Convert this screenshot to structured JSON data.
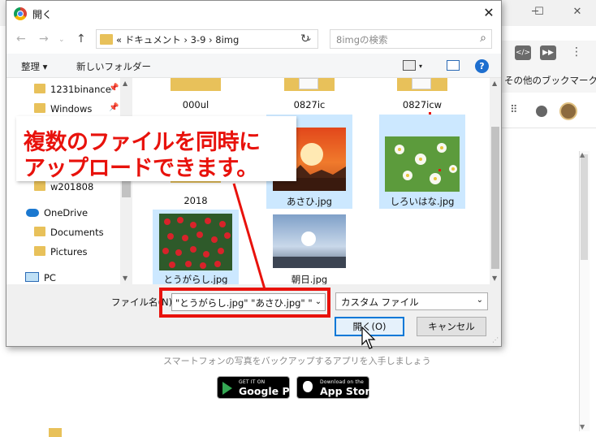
{
  "background": {
    "bookmarks_label": "その他のブックマーク",
    "ext_icons": [
      "code-icon",
      "media-icon"
    ],
    "caption": "スマートフォンの写真をバックアップするアプリを入手しましょう",
    "google_play": {
      "small": "GET IT ON",
      "big": "Google Play"
    },
    "app_store": {
      "small": "Download on the",
      "big": "App Store"
    }
  },
  "dialog": {
    "title": "開く",
    "breadcrumb": "« ドキュメント  ›  3-9  ›  8img",
    "search_placeholder": "8imgの検索",
    "organize": "整理 ▾",
    "new_folder": "新しいフォルダー",
    "nav_items": [
      {
        "label": "1231binance",
        "pinned": true
      },
      {
        "label": "Windows",
        "pinned": true
      },
      {
        "label": "w201808",
        "pinned": false
      },
      {
        "label": "OneDrive",
        "pinned": false
      },
      {
        "label": "Documents",
        "pinned": false
      },
      {
        "label": "Pictures",
        "pinned": false
      },
      {
        "label": "PC",
        "pinned": false
      }
    ],
    "files": [
      {
        "name": "000ul",
        "type": "folder"
      },
      {
        "name": "0827ic",
        "type": "folder"
      },
      {
        "name": "0827icw",
        "type": "folder"
      },
      {
        "name": "2018",
        "type": "folder"
      },
      {
        "name": "あさひ.jpg",
        "type": "image",
        "selected": true
      },
      {
        "name": "しろいはな.jpg",
        "type": "image",
        "selected": true
      },
      {
        "name": "とうがらし.jpg",
        "type": "image",
        "selected": true
      },
      {
        "name": "朝日.jpg",
        "type": "image",
        "selected": false
      }
    ],
    "filename_label": "ファイル名(N):",
    "filename_value": "\"とうがらし.jpg\" \"あさひ.jpg\" \"しろいはな.jpg\"",
    "filetype": "カスタム ファイル",
    "open_button": "開く(O)",
    "cancel_button": "キャンセル"
  },
  "annotation": {
    "line1": "複数のファイルを同時に",
    "line2": "アップロードできます。"
  },
  "colors": {
    "annotation_red": "#e8120c",
    "selection_blue": "#cce8ff",
    "accent": "#0078d7"
  }
}
